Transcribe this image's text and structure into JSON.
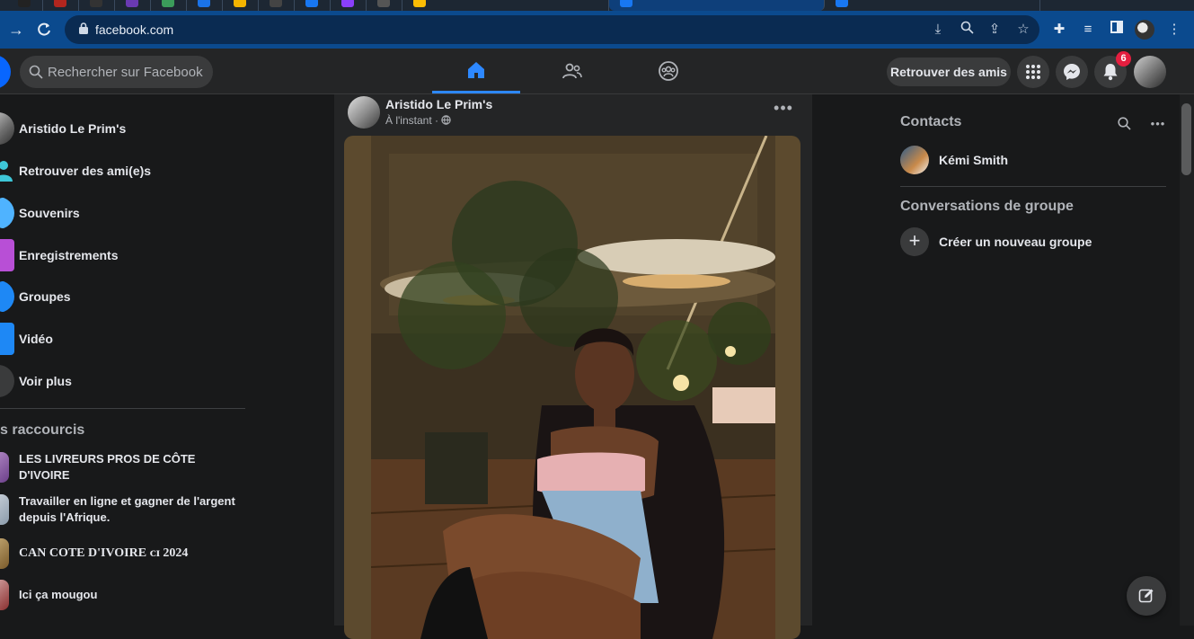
{
  "browser": {
    "url": "facebook.com",
    "colors": {
      "toolbar": "#0b4a8e",
      "omnibox": "#0a2b52"
    }
  },
  "header": {
    "search_placeholder": "Rechercher sur Facebook",
    "find_friends_label": "Retrouver des amis",
    "notification_count": "6",
    "colors": {
      "brand": "#0866ff",
      "badge": "#e41e3f",
      "active_tab": "#2d88ff"
    }
  },
  "left_sidebar": {
    "items": [
      {
        "label": "Aristido Le Prim's",
        "icon": "profile-avatar"
      },
      {
        "label": "Retrouver des ami(e)s",
        "icon": "friends-icon"
      },
      {
        "label": "Souvenirs",
        "icon": "memories-icon"
      },
      {
        "label": "Enregistrements",
        "icon": "saved-icon"
      },
      {
        "label": "Groupes",
        "icon": "groups-icon"
      },
      {
        "label": "Vidéo",
        "icon": "video-icon"
      },
      {
        "label": "Voir plus",
        "icon": "chevron-down-icon"
      }
    ],
    "shortcuts_title": "s raccourcis",
    "shortcuts": [
      {
        "label": "LES LIVREURS PROS DE CÔTE D'IVOIRE"
      },
      {
        "label": "Travailler en ligne et gagner de l'argent depuis l'Afrique."
      },
      {
        "label": "CAN CΟTE D'IVOIRE ᴄɪ 2024"
      },
      {
        "label": "Ici ça mougou"
      }
    ]
  },
  "post": {
    "author": "Aristido Le Prim's",
    "time": "À l'instant · ",
    "more": "•••"
  },
  "right_sidebar": {
    "contacts_title": "Contacts",
    "contacts": [
      {
        "name": "Kémi Smith"
      }
    ],
    "groups_title": "Conversations de groupe",
    "create_group_label": "Créer un nouveau groupe",
    "more": "•••"
  }
}
